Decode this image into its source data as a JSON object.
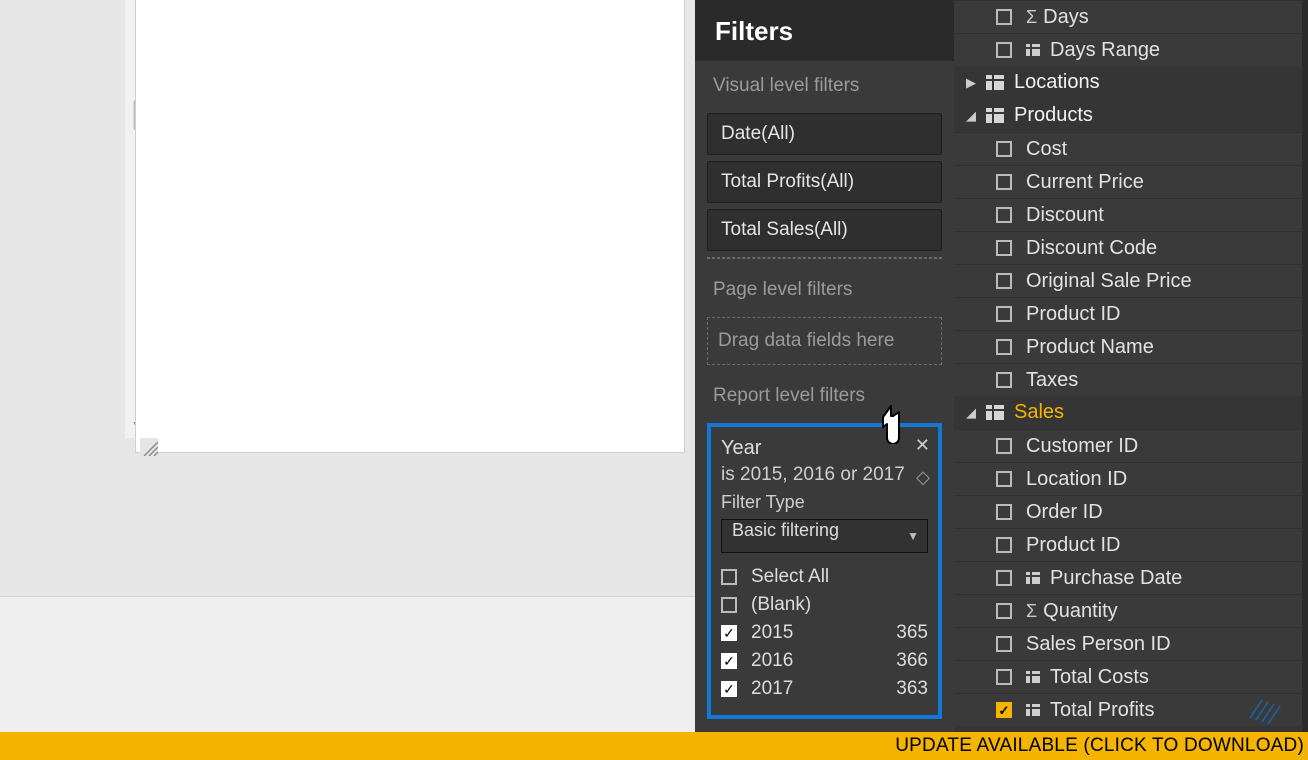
{
  "filters_panel": {
    "title": "Filters",
    "visual_level_title": "Visual level filters",
    "visual_filters": [
      {
        "label": "Date(All)"
      },
      {
        "label": "Total Profits(All)"
      },
      {
        "label": "Total Sales(All)"
      }
    ],
    "page_level_title": "Page level filters",
    "drop_hint": "Drag data fields here",
    "report_level_title": "Report level filters",
    "report_filter": {
      "field": "Year",
      "summary": "is 2015, 2016 or 2017",
      "type_label": "Filter Type",
      "type_value": "Basic filtering",
      "items": [
        {
          "label": "Select All",
          "count": "",
          "checked": false
        },
        {
          "label": "(Blank)",
          "count": "",
          "checked": false
        },
        {
          "label": "2015",
          "count": "365",
          "checked": true
        },
        {
          "label": "2016",
          "count": "366",
          "checked": true
        },
        {
          "label": "2017",
          "count": "363",
          "checked": true
        }
      ]
    }
  },
  "fields_panel": {
    "top_fields": [
      {
        "label": "Days",
        "sigma": true,
        "checked": false
      },
      {
        "label": "Days Range",
        "sigma": false,
        "tableicon": true,
        "checked": false
      }
    ],
    "tables": [
      {
        "name": "Locations",
        "expanded": false,
        "selected": false,
        "fields": []
      },
      {
        "name": "Products",
        "expanded": true,
        "selected": false,
        "fields": [
          {
            "label": "Cost",
            "checked": false
          },
          {
            "label": "Current Price",
            "checked": false
          },
          {
            "label": "Discount",
            "checked": false
          },
          {
            "label": "Discount Code",
            "checked": false
          },
          {
            "label": "Original Sale Price",
            "checked": false
          },
          {
            "label": "Product ID",
            "checked": false
          },
          {
            "label": "Product Name",
            "checked": false
          },
          {
            "label": "Taxes",
            "checked": false
          }
        ]
      },
      {
        "name": "Sales",
        "expanded": true,
        "selected": true,
        "fields": [
          {
            "label": "Customer ID",
            "checked": false
          },
          {
            "label": "Location ID",
            "checked": false
          },
          {
            "label": "Order ID",
            "checked": false
          },
          {
            "label": "Product ID",
            "checked": false
          },
          {
            "label": "Purchase Date",
            "checked": false,
            "tableicon": true
          },
          {
            "label": "Quantity",
            "checked": false,
            "sigma": true
          },
          {
            "label": "Sales Person ID",
            "checked": false
          },
          {
            "label": "Total Costs",
            "checked": false,
            "tableicon": true
          },
          {
            "label": "Total Profits",
            "checked": true,
            "tableicon": true
          }
        ]
      }
    ]
  },
  "update_bar": {
    "text": "UPDATE AVAILABLE (CLICK TO DOWNLOAD)"
  }
}
